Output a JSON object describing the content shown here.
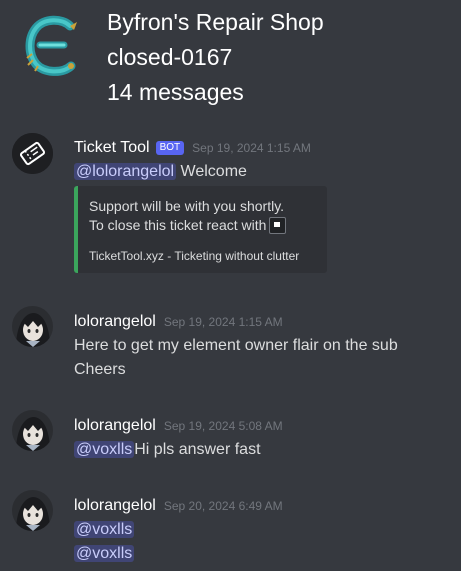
{
  "header": {
    "server_name": "Byfron's Repair Shop",
    "channel_name": "closed-0167",
    "message_count": "14 messages",
    "server_icon": "cyan-serpent-e-logo"
  },
  "messages": [
    {
      "author": "Ticket Tool",
      "bot_tag": "BOT",
      "timestamp": "Sep 19, 2024 1:15 AM",
      "mention": "@lolorangelol",
      "text": "Welcome",
      "avatar_icon": "ticket-icon",
      "embed": {
        "accent_color": "#3ba55c",
        "description_line1": "Support will be with you shortly.",
        "description_line2": "To close this ticket react with",
        "reaction_icon": "lock-emoji-icon",
        "footer": "TicketTool.xyz - Ticketing without clutter"
      }
    },
    {
      "author": "lolorangelol",
      "timestamp": "Sep 19, 2024 1:15 AM",
      "line1": "Here to get my element owner flair on the sub",
      "line2": "Cheers"
    },
    {
      "author": "lolorangelol",
      "timestamp": "Sep 19, 2024 5:08 AM",
      "mention": "@voxlls",
      "text": "Hi pls answer fast"
    },
    {
      "author": "lolorangelol",
      "timestamp": "Sep 20, 2024 6:49 AM",
      "mention1": "@voxlls",
      "mention2": "@voxlls"
    }
  ],
  "colors": {
    "background": "#36393f",
    "mention_bg": "#5865f2",
    "bot_tag": "#5865f2",
    "timestamp": "#72767d"
  }
}
